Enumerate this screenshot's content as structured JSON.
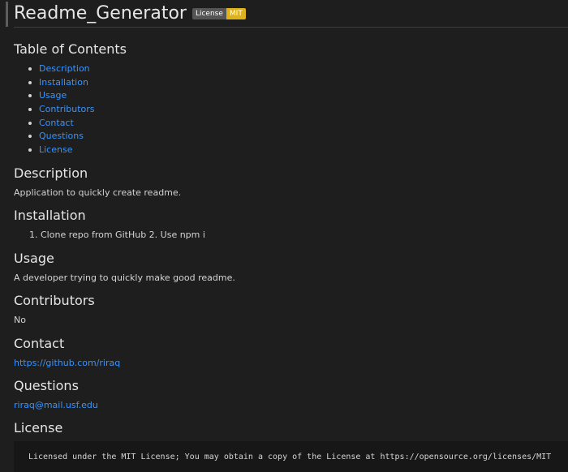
{
  "title": "Readme_Generator",
  "badge": {
    "label": "License",
    "value": "MIT",
    "value_color": "#dfb317",
    "label_color": "#555555"
  },
  "toc": {
    "heading": "Table of Contents",
    "items": [
      "Description",
      "Installation",
      "Usage",
      "Contributors",
      "Contact",
      "Questions",
      "License"
    ]
  },
  "sections": {
    "description": {
      "heading": "Description",
      "text": "Application to quickly create readme."
    },
    "installation": {
      "heading": "Installation",
      "item_number": "1.",
      "text": "Clone repo from GitHub 2. Use npm i"
    },
    "usage": {
      "heading": "Usage",
      "text": "A developer trying to quickly make good readme."
    },
    "contributors": {
      "heading": "Contributors",
      "text": "No"
    },
    "contact": {
      "heading": "Contact",
      "link": "https://github.com/riraq"
    },
    "questions": {
      "heading": "Questions",
      "link": "riraq@mail.usf.edu"
    },
    "license": {
      "heading": "License",
      "code": "Licensed under the MIT License; You may obtain a copy of the License at https://opensource.org/licenses/MIT"
    }
  },
  "colors": {
    "background": "#1e1e1e",
    "link": "#3794ff",
    "text": "#d4d4d4"
  }
}
